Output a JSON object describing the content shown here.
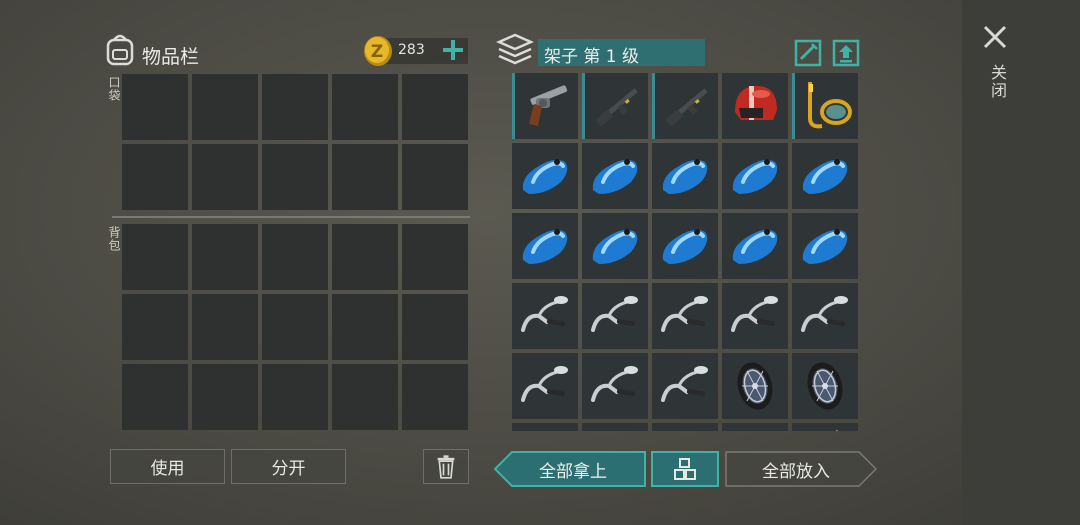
{
  "inventory": {
    "title": "物品栏",
    "coins": "283",
    "pocket_label": "口袋",
    "backpack_label": "背包"
  },
  "shelf": {
    "title": "架子 第 1 级",
    "items": [
      [
        "revolver",
        "rifle",
        "rifle",
        "helmet",
        "snorkel"
      ],
      [
        "fuel-tank",
        "fuel-tank",
        "fuel-tank",
        "fuel-tank",
        "fuel-tank"
      ],
      [
        "fuel-tank",
        "fuel-tank",
        "fuel-tank",
        "fuel-tank",
        "fuel-tank"
      ],
      [
        "handlebar",
        "handlebar",
        "handlebar",
        "handlebar",
        "handlebar"
      ],
      [
        "handlebar",
        "handlebar",
        "handlebar",
        "wheel",
        "wheel"
      ]
    ]
  },
  "buttons": {
    "use": "使用",
    "split": "分开",
    "take_all": "全部拿上",
    "put_all": "全部放入",
    "close": "关闭"
  },
  "icons": {
    "backpack": "backpack-icon",
    "coin": "coin-icon",
    "add": "plus-icon",
    "shelf": "shelf-icon",
    "sort": "sort-icon",
    "upgrade": "upgrade-icon",
    "trash": "trash-icon",
    "grid": "grid-icon",
    "close": "close-icon"
  },
  "colors": {
    "accent": "#3a9aa0",
    "coin": "#d9a521"
  }
}
